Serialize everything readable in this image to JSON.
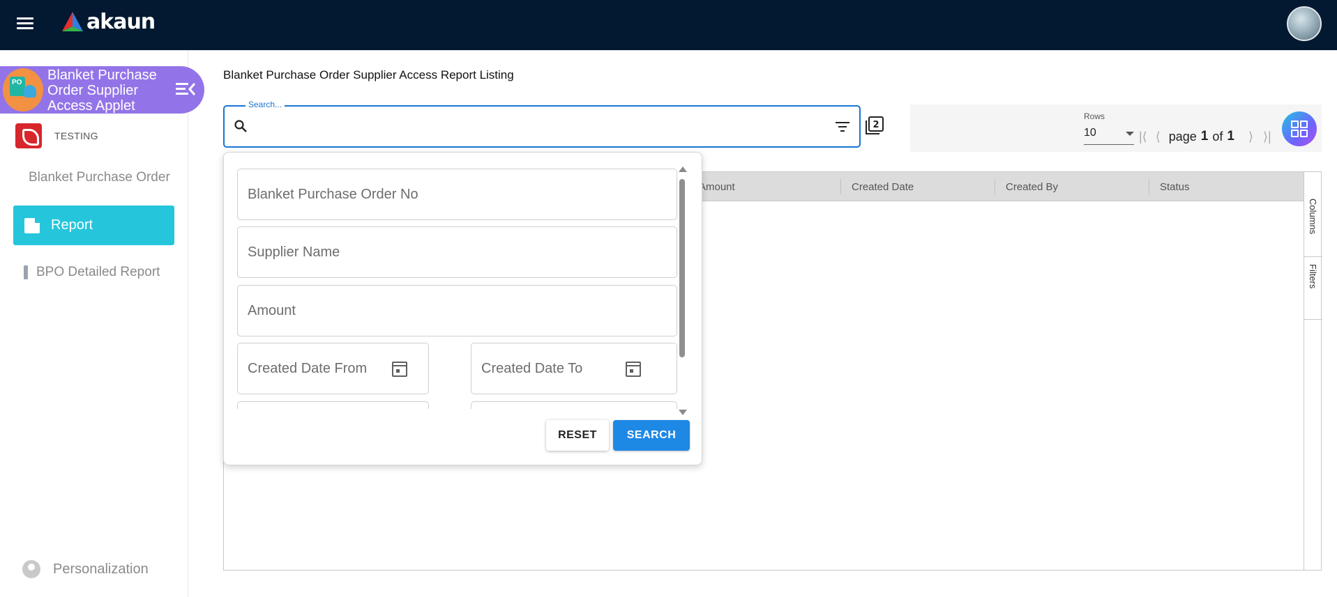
{
  "app": {
    "logo_text": "akaun"
  },
  "sidebar": {
    "applet_title": "Blanket Purchase Order Supplier Access Applet",
    "applet_icon_text": "PO",
    "org_label": "TESTING",
    "items": [
      {
        "label": "Blanket Purchase Order"
      },
      {
        "label": "Report"
      },
      {
        "label": "BPO Detailed Report"
      }
    ],
    "personalization_label": "Personalization"
  },
  "main": {
    "page_title": "Blanket Purchase Order Supplier Access Report Listing",
    "search": {
      "legend": "Search...",
      "value": ""
    },
    "stack_badge": "2",
    "pagination": {
      "rows_label": "Rows",
      "rows_value": "10",
      "page_word": "page",
      "current_page": "1",
      "of_word": "of",
      "total_pages": "1"
    },
    "grid": {
      "columns": [
        "Amount",
        "Created Date",
        "Created By",
        "Status"
      ],
      "side_tabs": [
        "Columns",
        "Filters"
      ]
    }
  },
  "search_panel": {
    "fields": {
      "bpo_no": "Blanket Purchase Order No",
      "supplier_name": "Supplier Name",
      "amount": "Amount",
      "created_date_from": "Created Date From",
      "created_date_to": "Created Date To"
    },
    "reset_label": "RESET",
    "search_label": "SEARCH"
  },
  "colors": {
    "topbar": "#031931",
    "applet_header": "#9374e8",
    "active_item": "#25c6dc",
    "primary": "#1e88e5"
  }
}
